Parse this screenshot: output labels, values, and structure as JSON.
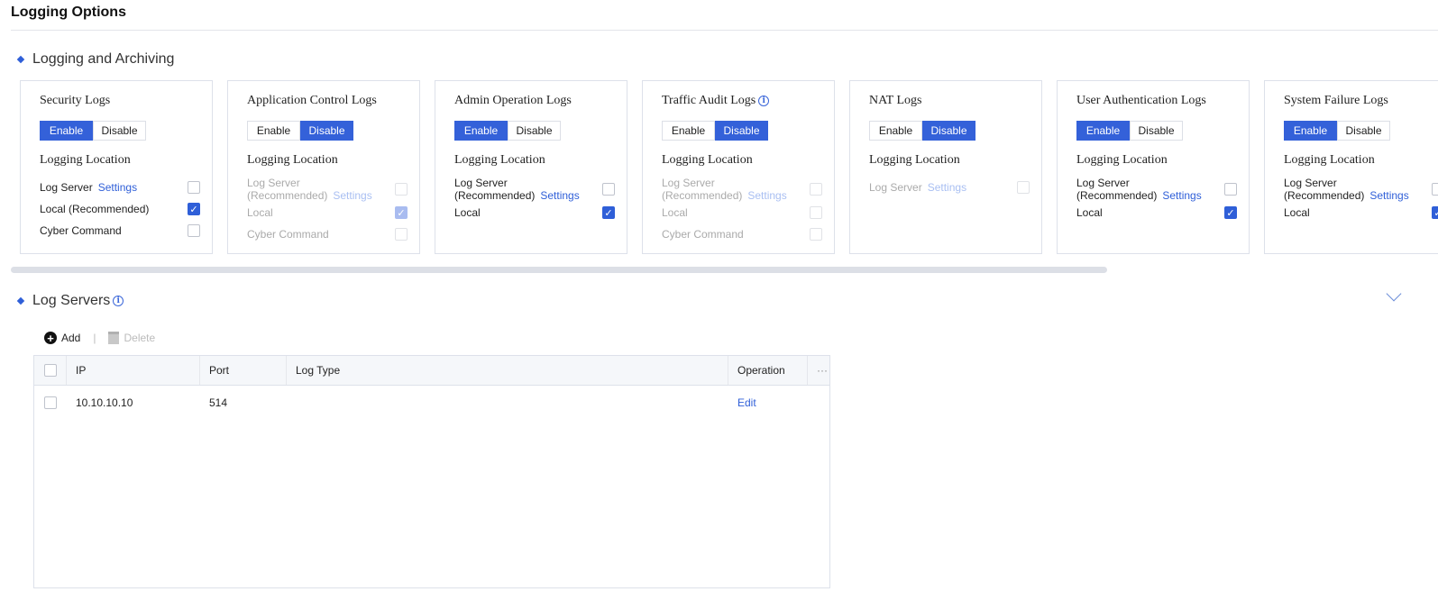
{
  "page_title": "Logging Options",
  "section1": "Logging and Archiving",
  "enable_label": "Enable",
  "disable_label": "Disable",
  "logging_location": "Logging Location",
  "settings_label": "Settings",
  "cards": [
    {
      "title": "Security Logs",
      "info": false,
      "enabled": true,
      "rows": [
        {
          "label": "Log Server",
          "settings": true,
          "checked": false
        },
        {
          "label": "Local (Recommended)",
          "checked": true
        },
        {
          "label": "Cyber Command",
          "checked": false
        }
      ]
    },
    {
      "title": "Application Control Logs",
      "info": false,
      "enabled": false,
      "rows": [
        {
          "label": "Log Server (Recommended)",
          "settings": true,
          "checked": false
        },
        {
          "label": "Local",
          "checked": true
        },
        {
          "label": "Cyber Command",
          "checked": false
        }
      ]
    },
    {
      "title": "Admin Operation Logs",
      "info": false,
      "enabled": true,
      "rows": [
        {
          "label": "Log Server (Recommended)",
          "settings": true,
          "checked": false
        },
        {
          "label": "Local",
          "checked": true
        }
      ]
    },
    {
      "title": "Traffic Audit Logs",
      "info": true,
      "enabled": false,
      "rows": [
        {
          "label": "Log Server (Recommended)",
          "settings": true,
          "checked": false
        },
        {
          "label": "Local",
          "checked": false
        },
        {
          "label": "Cyber Command",
          "checked": false
        }
      ]
    },
    {
      "title": "NAT Logs",
      "info": false,
      "enabled": false,
      "rows": [
        {
          "label": "Log Server",
          "settings": true,
          "checked": false
        }
      ]
    },
    {
      "title": "User Authentication Logs",
      "info": false,
      "enabled": true,
      "rows": [
        {
          "label": "Log Server (Recommended)",
          "settings": true,
          "checked": false
        },
        {
          "label": "Local",
          "checked": true
        }
      ]
    },
    {
      "title": "System Failure Logs",
      "info": false,
      "enabled": true,
      "rows": [
        {
          "label": "Log Server (Recommended)",
          "settings": true,
          "checked": false
        },
        {
          "label": "Local",
          "checked": true
        }
      ]
    }
  ],
  "section2": "Log Servers",
  "toolbar": {
    "add": "Add",
    "delete": "Delete"
  },
  "table": {
    "headers": [
      "IP",
      "Port",
      "Log Type",
      "Operation"
    ],
    "more": "···",
    "rows": [
      {
        "ip": "10.10.10.10",
        "port": "514",
        "log_type": "",
        "operation": "Edit"
      }
    ]
  },
  "colors": {
    "accent": "#3461d9"
  }
}
